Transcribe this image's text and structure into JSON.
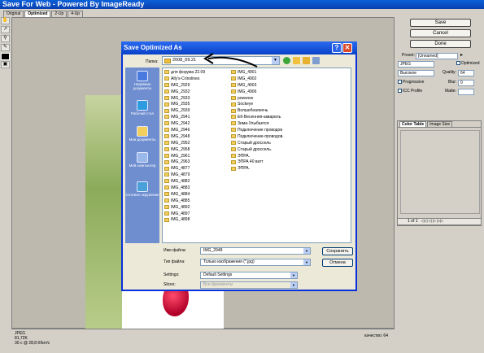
{
  "window": {
    "title": "Save For Web - Powered By ImageReady"
  },
  "view_tabs": [
    "Original",
    "Optimized",
    "2-Up",
    "4-Up"
  ],
  "tools": [
    {
      "icon": "hand-icon"
    },
    {
      "icon": "slice-select-icon"
    },
    {
      "icon": "zoom-icon"
    },
    {
      "icon": "eyedropper-icon"
    }
  ],
  "status": {
    "format": "JPEG",
    "size": "81,72K",
    "time": "30 с @ 28,8 Кбит/с",
    "quality": "качество: 64"
  },
  "panel": {
    "save": "Save",
    "cancel": "Cancel",
    "done": "Done",
    "preset_label": "Preset:",
    "preset_value": "[Unnamed]",
    "format": "JPEG",
    "optimized": "Optimized",
    "quality_level": "Высокое",
    "quality_label": "Quality:",
    "quality_value": "64",
    "progressive": "Progressive",
    "blur_label": "Blur:",
    "blur_value": "0",
    "icc": "ICC Profile",
    "matte_label": "Matte:",
    "tab_color_table": "Color Table",
    "tab_image_size": "Image Size",
    "pager": "1 of 1"
  },
  "dialog": {
    "title": "Save Optimized As",
    "folder_label": "Папка:",
    "folder_value": "2008_09.21",
    "places": [
      "Недавние документы",
      "Рабочий стол",
      "Мои документы",
      "Мой компьютер",
      "Сетевое окружение"
    ],
    "files_col1": [
      "для форума 22.09",
      "Ally's-Crinolines",
      "IMG_2929",
      "IMG_2932",
      "IMG_2933",
      "IMG_2935",
      "IMG_2939",
      "IMG_2941",
      "IMG_2942",
      "IMG_2946",
      "IMG_2948",
      "IMG_2952",
      "IMG_2958",
      "IMG_2961",
      "IMG_2963",
      "IMG_4877",
      "IMG_4879",
      "IMG_4882",
      "IMG_4883",
      "IMG_4884",
      "IMG_4885",
      "IMG_4892",
      "IMG_4897",
      "IMG_4898"
    ],
    "files_col2": [
      "IMG_4901",
      "IMG_4902",
      "IMG_4903",
      "IMG_4906",
      "powwow",
      "Sockeye",
      "Волшебнаяночь",
      "ЕК-Весенняя-акварель",
      "Зима-Улыбается",
      "Подключение проводов",
      "Подключение-проводов.",
      "Старый дроссель",
      "Старый дроссель.",
      "ЭПРА.",
      "ЭПРА 40 ватт",
      "ЭПРА."
    ],
    "filename_label": "Имя файла:",
    "filename_value": "IMG_2948",
    "filetype_label": "Тип файла:",
    "filetype_value": "Только изображения (*.jpg)",
    "settings_label": "Settings:",
    "settings_value": "Default Settings",
    "slices_label": "Slices:",
    "slices_value": "Все фрагменты",
    "save_button": "Сохранить",
    "cancel_button": "Отмена"
  }
}
